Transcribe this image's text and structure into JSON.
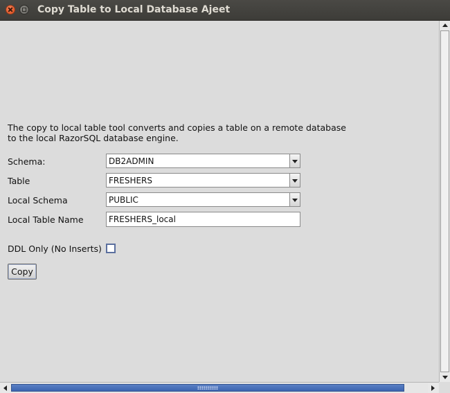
{
  "window": {
    "title": "Copy Table to Local Database Ajeet"
  },
  "description": {
    "line1": "The copy to local table tool converts and copies a table on a remote database",
    "line2": "to the local RazorSQL database engine."
  },
  "form": {
    "schema_label": "Schema:",
    "schema_value": "DB2ADMIN",
    "table_label": "Table",
    "table_value": "FRESHERS",
    "local_schema_label": "Local Schema",
    "local_schema_value": "PUBLIC",
    "local_table_name_label": "Local Table Name",
    "local_table_name_value": "FRESHERS_local",
    "ddl_only_label": "DDL Only (No Inserts)",
    "ddl_only_checked": false
  },
  "actions": {
    "copy_label": "Copy"
  },
  "colors": {
    "titlebar": "#3d3c38",
    "background": "#dcdcdc",
    "scrollbar_thumb": "#3c64b0",
    "close_button": "#df4a16"
  },
  "icons": [
    "close-icon",
    "maximize-icon",
    "dropdown-arrow-icon",
    "scroll-up-icon",
    "scroll-down-icon",
    "scroll-left-icon",
    "scroll-right-icon"
  ]
}
